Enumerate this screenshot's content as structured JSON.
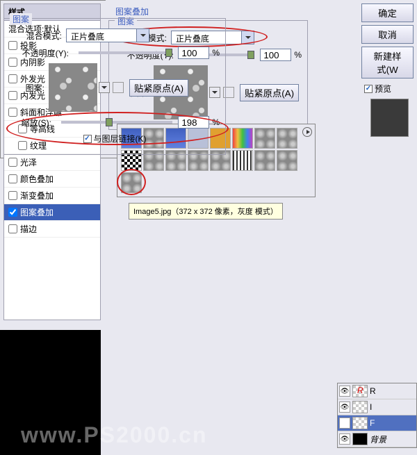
{
  "styles_panel": {
    "header": "样式",
    "blend_options": "混合选项:默认",
    "items": [
      {
        "label": "投影",
        "checked": false
      },
      {
        "label": "内阴影",
        "checked": false
      },
      {
        "label": "外发光",
        "checked": false
      },
      {
        "label": "内发光",
        "checked": false
      },
      {
        "label": "斜面和浮雕",
        "checked": false
      },
      {
        "label": "等高线",
        "checked": false,
        "sub": true
      },
      {
        "label": "纹理",
        "checked": false,
        "sub": true
      },
      {
        "label": "光泽",
        "checked": false
      },
      {
        "label": "颜色叠加",
        "checked": false
      },
      {
        "label": "渐变叠加",
        "checked": false
      },
      {
        "label": "图案叠加",
        "checked": true,
        "selected": true
      },
      {
        "label": "描边",
        "checked": false
      }
    ]
  },
  "pattern_section": {
    "title": "图案叠加",
    "fieldset_title": "图案",
    "blend_mode_label": "混合模式:",
    "blend_mode_value": "正片叠底",
    "opacity_label": "不透明度(Y):",
    "opacity_value": "100",
    "percent": "%",
    "pattern_label": "图案:",
    "snap_origin": "贴紧原点(A)",
    "scale_label": "缩放(S):",
    "scale_value": "198",
    "link_layer": "与图层链接(K)"
  },
  "tooltip": "Image5.jpg（372 x 372 像素，灰度 模式）",
  "buttons": {
    "ok": "确定",
    "cancel": "取消",
    "new_style": "新建样式(W",
    "preview": "预览"
  },
  "layers": {
    "items": [
      {
        "label": "R"
      },
      {
        "label": "I"
      },
      {
        "label": "F",
        "selected": true
      },
      {
        "label": "背景"
      }
    ]
  },
  "watermark": "www.PS2000.cn"
}
